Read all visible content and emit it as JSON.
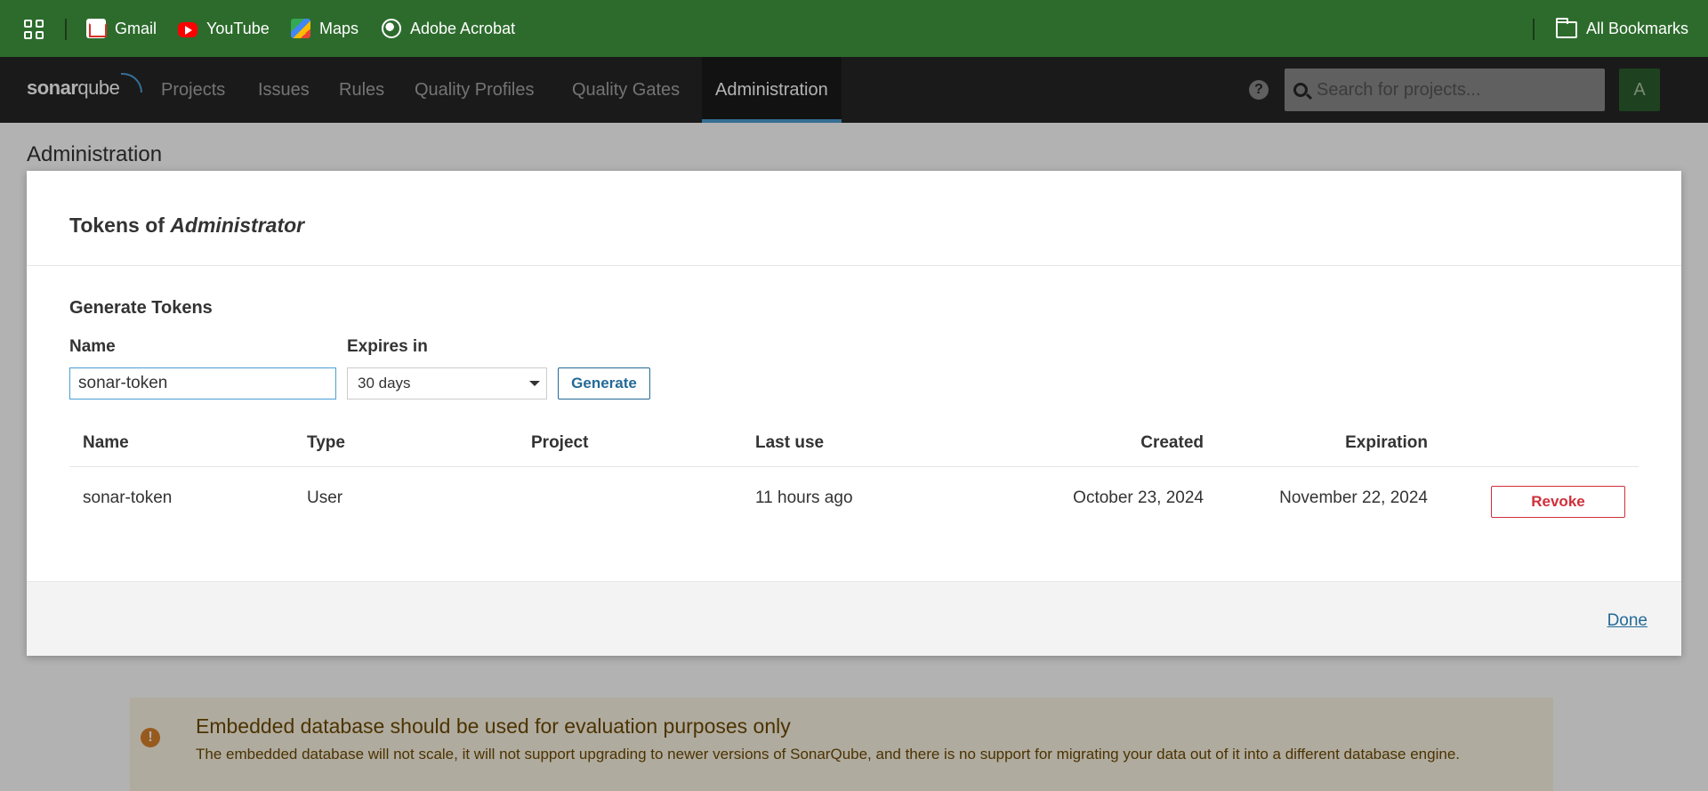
{
  "bookmarks": {
    "items": [
      {
        "label": "Gmail",
        "icon": "gmail-icon"
      },
      {
        "label": "YouTube",
        "icon": "youtube-icon"
      },
      {
        "label": "Maps",
        "icon": "maps-icon"
      },
      {
        "label": "Adobe Acrobat",
        "icon": "globe-icon"
      }
    ],
    "all_bookmarks": "All Bookmarks"
  },
  "nav": {
    "logo_prefix": "sonar",
    "logo_suffix": "qube",
    "items": [
      "Projects",
      "Issues",
      "Rules",
      "Quality Profiles",
      "Quality Gates",
      "Administration"
    ],
    "active": "Administration",
    "help": "?",
    "search_placeholder": "Search for projects...",
    "avatar": "A"
  },
  "page": {
    "title": "Administration"
  },
  "modal": {
    "title_prefix": "Tokens of ",
    "title_user": "Administrator",
    "section": "Generate Tokens",
    "name_label": "Name",
    "name_value": "sonar-token",
    "expires_label": "Expires in",
    "expires_value": "30 days",
    "generate": "Generate",
    "table": {
      "headers": [
        "Name",
        "Type",
        "Project",
        "Last use",
        "Created",
        "Expiration"
      ],
      "rows": [
        {
          "name": "sonar-token",
          "type": "User",
          "project": "",
          "last_use": "11 hours ago",
          "created": "October 23, 2024",
          "expiration": "November 22, 2024",
          "action": "Revoke"
        }
      ]
    },
    "done": "Done"
  },
  "warning": {
    "icon": "!",
    "title": "Embedded database should be used for evaluation purposes only",
    "text": "The embedded database will not scale, it will not support upgrading to newer versions of SonarQube, and there is no support for migrating your data out of it into a different database engine."
  },
  "colors": {
    "bookmarks_bg": "#2d6b2d",
    "nav_bg": "#262626",
    "accent": "#4b9fd5",
    "link": "#236a97",
    "danger": "#d02f3a"
  }
}
